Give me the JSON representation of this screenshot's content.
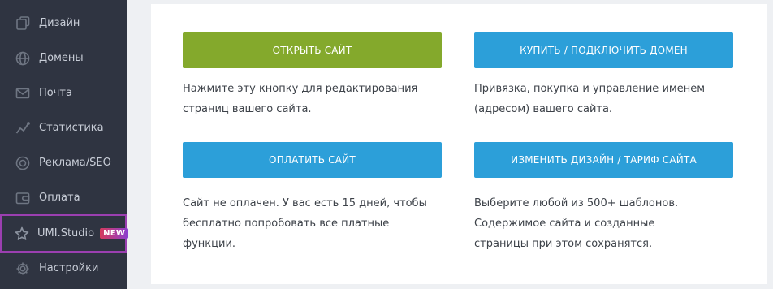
{
  "sidebar": {
    "items": [
      {
        "label": "Дизайн",
        "icon": "design-icon"
      },
      {
        "label": "Домены",
        "icon": "globe-icon"
      },
      {
        "label": "Почта",
        "icon": "mail-icon"
      },
      {
        "label": "Статистика",
        "icon": "chart-icon"
      },
      {
        "label": "Реклама/SEO",
        "icon": "target-icon"
      },
      {
        "label": "Оплата",
        "icon": "wallet-icon"
      },
      {
        "label": "UMI.Studio",
        "icon": "star-icon",
        "badge": "NEW"
      },
      {
        "label": "Настройки",
        "icon": "gear-icon"
      }
    ]
  },
  "main": {
    "open_site": {
      "button": "ОТКРЫТЬ САЙТ",
      "desc": "Нажмите эту кнопку для редактирования страниц вашего сайта."
    },
    "domain": {
      "button": "КУПИТЬ / ПОДКЛЮЧИТЬ ДОМЕН",
      "desc": "Привязка, покупка и управление именем (адресом) вашего сайта."
    },
    "pay": {
      "button": "ОПЛАТИТЬ САЙТ",
      "desc": "Сайт не оплачен. У вас есть 15 дней, чтобы бесплатно попробовать все платные функции."
    },
    "design": {
      "button": "ИЗМЕНИТЬ ДИЗАЙН / ТАРИФ САЙТА",
      "desc": "Выберите любой из 500+ шаблонов. Содержимое сайта и созданные страницы при этом сохранятся."
    }
  },
  "colors": {
    "sidebar_bg": "#2f3441",
    "green_button": "#84a92c",
    "blue_button": "#2c9fd9",
    "highlight_border": "#9b3fb0"
  }
}
